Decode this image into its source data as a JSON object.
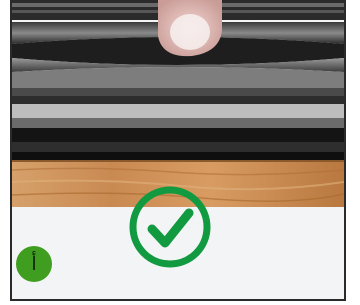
{
  "colors": {
    "frame": "#2a2a2a",
    "panel_bg": "#f3f4f6",
    "check_ring": "#119a3f",
    "badge_fill": "#3f9e1f",
    "wood": "#c98a52",
    "rubber": "#1c1c1c"
  },
  "icons": {
    "check": "check-circle-icon",
    "badge": "letter-badge"
  },
  "badge": {
    "label": "أ"
  }
}
